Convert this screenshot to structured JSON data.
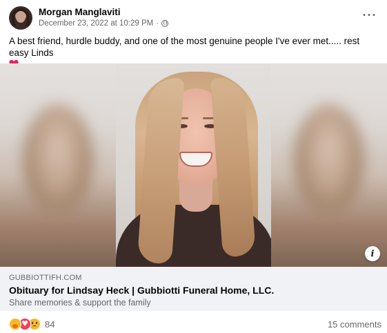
{
  "post": {
    "author": "Morgan Manglaviti",
    "timestamp": "December 23, 2022 at 10:29 PM",
    "separator": "·",
    "privacy_icon": "globe-icon",
    "more_icon": "more-options-icon",
    "more_label": "···",
    "text": "A best friend, hurdle buddy, and one of the most genuine people I've ever met..... rest easy Linds",
    "emoji": "red-heart"
  },
  "link_preview": {
    "domain": "GUBBIOTTIFH.COM",
    "title": "Obituary for Lindsay Heck | Gubbiotti Funeral Home, LLC.",
    "description": "Share memories & support the family",
    "info_label": "i"
  },
  "footer": {
    "reactions": [
      "care",
      "love",
      "sad"
    ],
    "reaction_count": "84",
    "comments": "15 comments"
  },
  "colors": {
    "secondary_text": "#65676b",
    "card_background": "#f0f2f5",
    "love_red": "#f33e58",
    "reaction_yellow": "#f7b928"
  }
}
